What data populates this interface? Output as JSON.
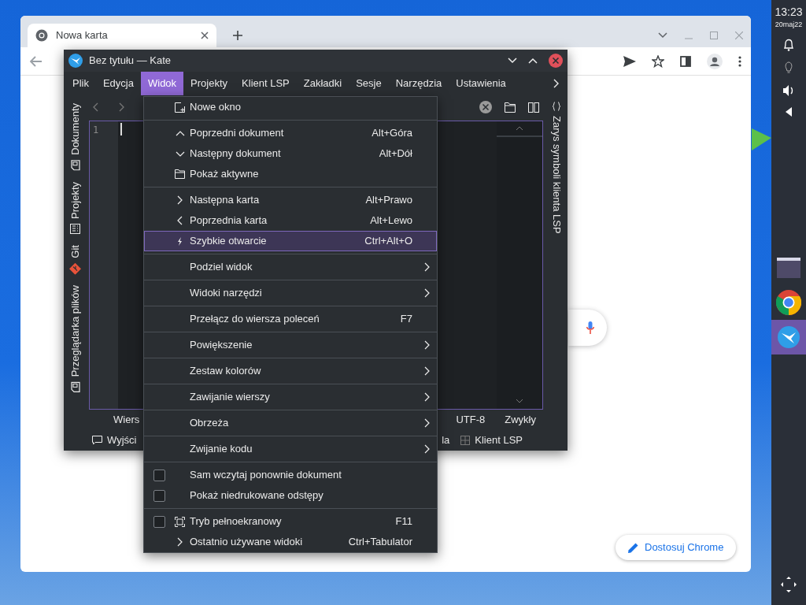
{
  "desktop": {
    "panel": {
      "time": "13:23",
      "date": "20maj22"
    },
    "taskbar": [
      {
        "selected": false
      },
      {
        "selected": false
      },
      {
        "selected": true
      }
    ]
  },
  "chrome": {
    "tab": "Nowa karta",
    "customize_button": "Dostosuj Chrome"
  },
  "kate": {
    "title": "Bez tytułu — Kate",
    "menubar": [
      {
        "label": "Plik",
        "selected": false
      },
      {
        "label": "Edycja",
        "selected": false
      },
      {
        "label": "Widok",
        "selected": true
      },
      {
        "label": "Projekty",
        "selected": false
      },
      {
        "label": "Klient LSP",
        "selected": false
      },
      {
        "label": "Zakładki",
        "selected": false
      },
      {
        "label": "Sesje",
        "selected": false
      },
      {
        "label": "Narzędzia",
        "selected": false
      },
      {
        "label": "Ustawienia",
        "selected": false
      }
    ],
    "left_tabs": [
      "Dokumenty",
      "Projekty",
      "Git",
      "Przeglądarka plików"
    ],
    "right_tabs": [
      "Zarys symboli klienta LSP"
    ],
    "editor": {
      "line_numbers": [
        "1"
      ]
    },
    "status_bar": [
      "Wiers",
      "UTF-8",
      "Zwykły"
    ],
    "bottom_tabs": [
      "Wyjści",
      "la",
      "Klient LSP"
    ]
  },
  "menu": {
    "sections": [
      [
        {
          "kind": "action",
          "label": "Nowe okno",
          "selected": false
        }
      ],
      [
        {
          "kind": "action",
          "label": "Poprzedni dokument",
          "shortcut": "Alt+Góra",
          "selected": false
        },
        {
          "kind": "action",
          "label": "Następny dokument",
          "shortcut": "Alt+Dół",
          "selected": false
        },
        {
          "kind": "action",
          "label": "Pokaż aktywne",
          "selected": false
        }
      ],
      [
        {
          "kind": "action",
          "label": "Następna karta",
          "shortcut": "Alt+Prawo",
          "selected": false
        },
        {
          "kind": "action",
          "label": "Poprzednia karta",
          "shortcut": "Alt+Lewo",
          "selected": false
        },
        {
          "kind": "action",
          "label": "Szybkie otwarcie",
          "shortcut": "Ctrl+Alt+O",
          "selected": true
        }
      ],
      [
        {
          "kind": "submenu",
          "label": "Podziel widok",
          "selected": false
        }
      ],
      [
        {
          "kind": "submenu",
          "label": "Widoki narzędzi",
          "selected": false
        }
      ],
      [
        {
          "kind": "action",
          "label": "Przełącz do wiersza poleceń",
          "shortcut": "F7",
          "selected": false
        }
      ],
      [
        {
          "kind": "submenu",
          "label": "Powiększenie",
          "selected": false
        }
      ],
      [
        {
          "kind": "submenu",
          "label": "Zestaw kolorów",
          "selected": false
        }
      ],
      [
        {
          "kind": "submenu",
          "label": "Zawijanie wierszy",
          "selected": false
        }
      ],
      [
        {
          "kind": "submenu",
          "label": "Obrzeża",
          "selected": false
        }
      ],
      [
        {
          "kind": "submenu",
          "label": "Zwijanie kodu",
          "selected": false
        }
      ],
      [
        {
          "kind": "checkbox",
          "label": "Sam wczytaj ponownie dokument",
          "checked": false,
          "selected": false
        },
        {
          "kind": "checkbox",
          "label": "Pokaż niedrukowane odstępy",
          "checked": false,
          "selected": false
        }
      ],
      [
        {
          "kind": "checkbox",
          "label": "Tryb pełnoekranowy",
          "shortcut": "F11",
          "checked": false,
          "selected": false
        },
        {
          "kind": "action",
          "label": "Ostatnio używane widoki",
          "shortcut": "Ctrl+Tabulator",
          "selected": false
        }
      ]
    ]
  }
}
